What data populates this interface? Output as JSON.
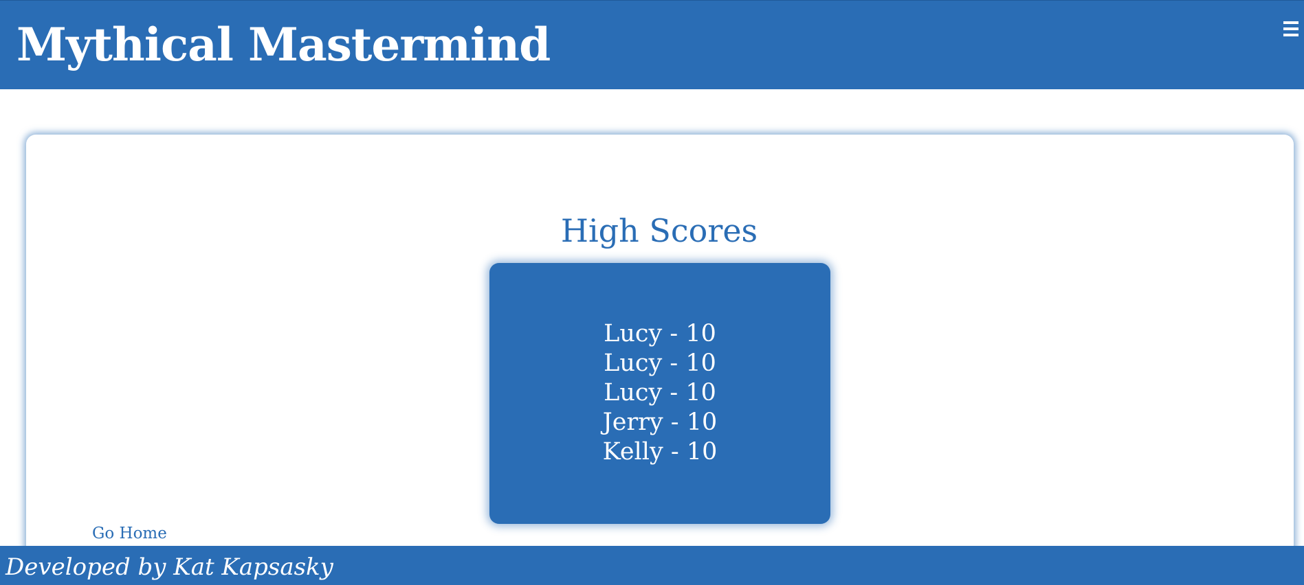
{
  "header": {
    "title": "Mythical Mastermind",
    "menu_icon": "hamburger-menu-icon"
  },
  "main": {
    "heading": "High Scores",
    "scores": [
      "Lucy - 10",
      "Lucy - 10",
      "Lucy - 10",
      "Jerry - 10",
      "Kelly - 10"
    ],
    "go_home_label": "Go Home"
  },
  "footer": {
    "credit": "Developed by Kat Kapsasky"
  },
  "colors": {
    "brand": "#2a6db5",
    "background": "#ffffff",
    "text_on_brand": "#ffffff"
  }
}
